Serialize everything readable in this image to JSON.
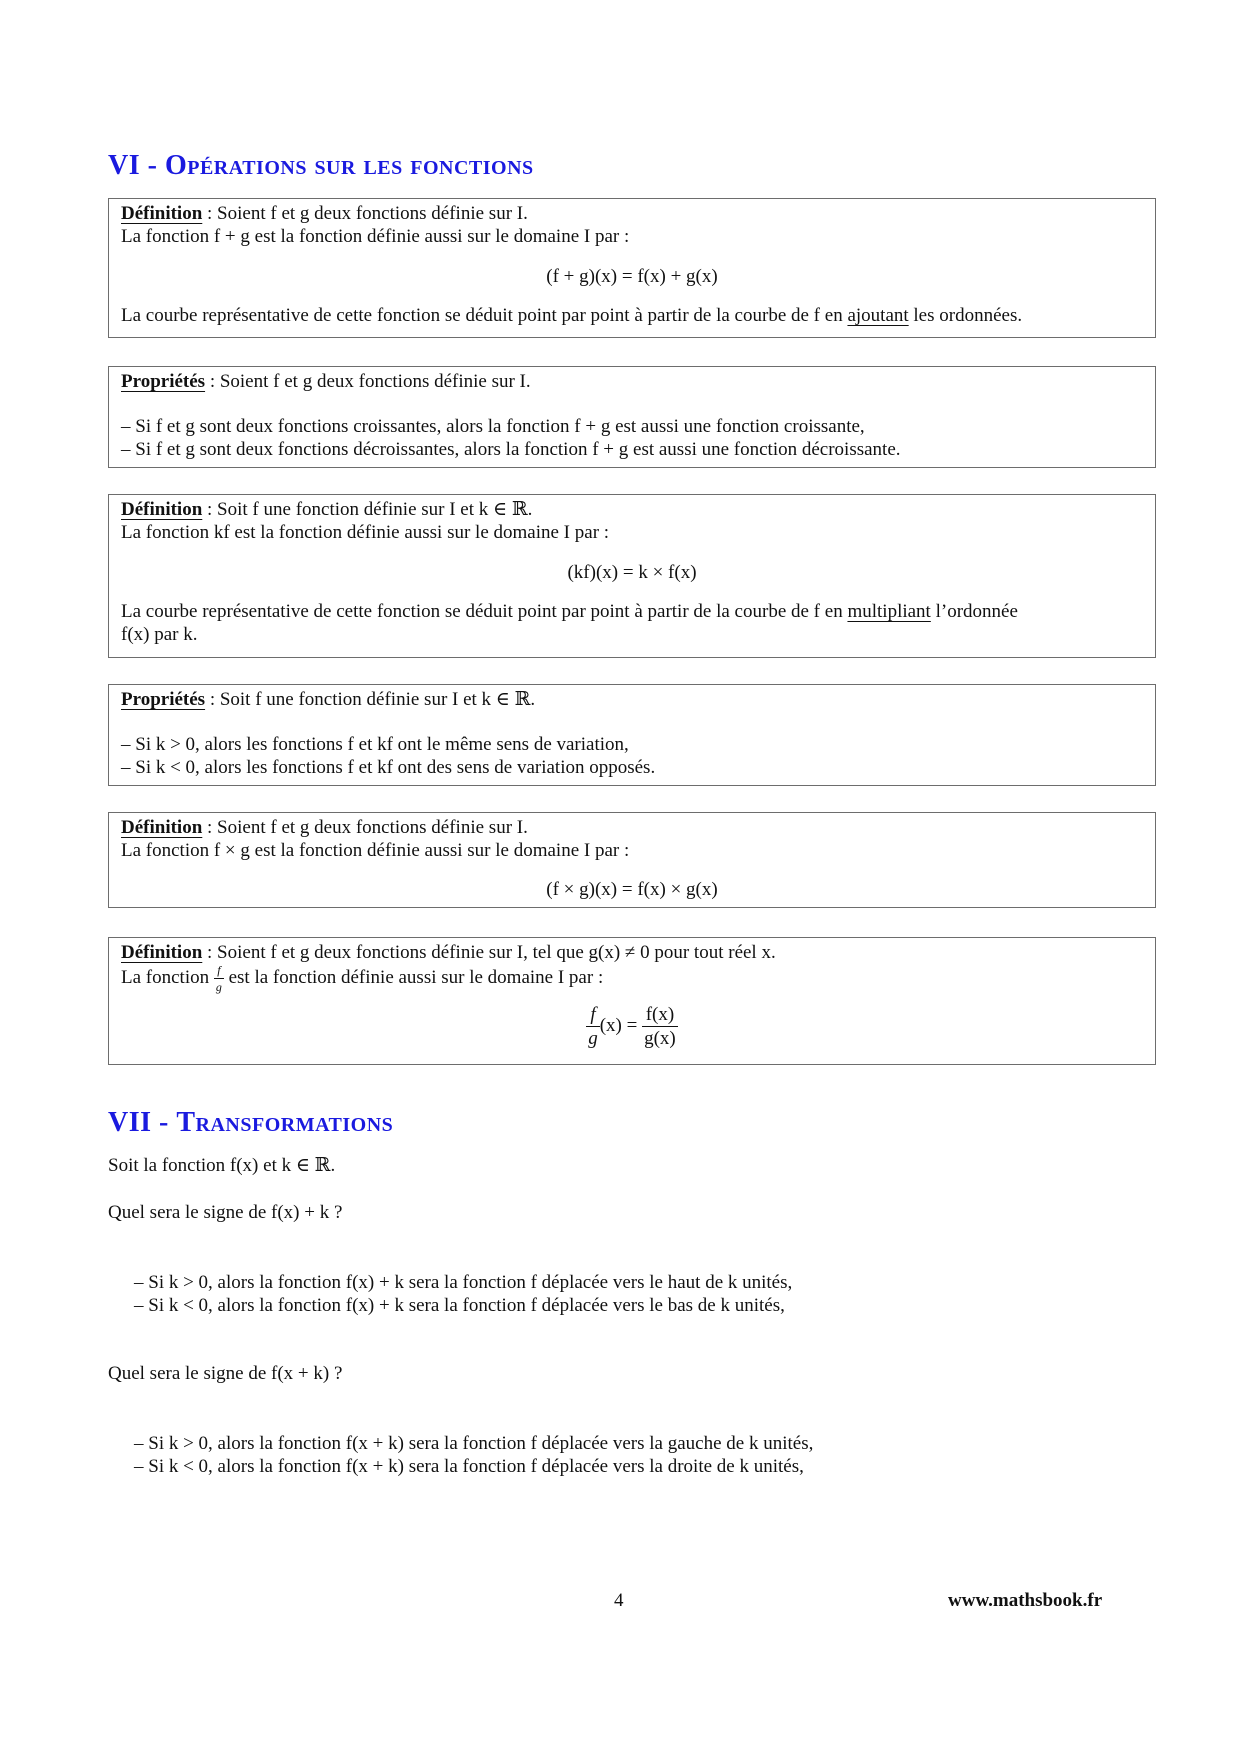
{
  "section6": {
    "number": "VI - ",
    "title": "Opérations sur les fonctions"
  },
  "box1": {
    "keyword": "Définition",
    "line1_rest": " : Soient f et g deux fonctions définie sur I.",
    "line2": "La fonction f + g est la fonction définie aussi sur le domaine I par :",
    "equation": "(f + g)(x) = f(x) + g(x)",
    "line3_before": "La courbe représentative de cette fonction se déduit point par point à partir de la courbe de f en ",
    "line3_underlined": "ajoutant",
    "line3_after": " les ordonnées."
  },
  "box2": {
    "keyword": "Propriétés",
    "line1_rest": " : Soient f et g deux fonctions définie sur I.",
    "items": [
      "– Si f et g sont deux fonctions croissantes, alors la fonction f + g est aussi une fonction croissante,",
      "– Si f et g sont deux fonctions décroissantes, alors la fonction f + g est aussi une fonction décroissante."
    ]
  },
  "box3": {
    "keyword": "Définition",
    "line1_rest": " : Soit f une fonction définie sur I et k ∈ ℝ.",
    "line2": "La fonction kf est la fonction définie aussi sur le domaine I par :",
    "equation": "(kf)(x) = k × f(x)",
    "line3_before": "La courbe représentative de cette fonction se déduit point par point à partir de la courbe de f en ",
    "line3_underlined": "multipliant",
    "line3_after": " l’ordonnée",
    "line4": "f(x) par k."
  },
  "box4": {
    "keyword": "Propriétés",
    "line1_rest": " : Soit f une fonction définie sur I et k ∈ ℝ.",
    "items": [
      "– Si k > 0, alors les fonctions f et kf ont le même sens de variation,",
      "– Si k < 0, alors les fonctions f et kf ont des sens de variation opposés."
    ]
  },
  "box5": {
    "keyword": "Définition",
    "line1_rest": " : Soient f et g deux fonctions définie sur I.",
    "line2": "La fonction f × g est la fonction définie aussi sur le domaine I par :",
    "equation": "(f × g)(x) = f(x) × g(x)"
  },
  "box6": {
    "keyword": "Définition",
    "line1_rest": " : Soient f et g deux fonctions définie sur I, tel que g(x) ≠ 0 pour tout réel x.",
    "line2_before": "La fonction ",
    "line2_frac_num": "f",
    "line2_frac_den": "g",
    "line2_after": " est la fonction définie aussi sur le domaine I par :",
    "eq_lhs_num": "f",
    "eq_lhs_den": "g",
    "eq_mid": "(x) = ",
    "eq_rhs_num": "f(x)",
    "eq_rhs_den": "g(x)"
  },
  "section7": {
    "number": "VII - ",
    "title": "Transformations",
    "intro": "Soit la fonction f(x) et k ∈ ℝ.",
    "question1": "Quel sera le signe de f(x) + k ?",
    "items1": [
      "– Si k > 0, alors la fonction f(x) + k sera la fonction f déplacée vers le haut de k unités,",
      "– Si k < 0, alors la fonction f(x) + k sera la fonction f déplacée vers le bas de k unités,"
    ],
    "question2": "Quel sera le signe de f(x + k) ?",
    "items2": [
      "– Si k > 0, alors la fonction f(x + k) sera la fonction f déplacée vers la gauche de k unités,",
      "– Si k < 0, alors la fonction f(x + k) sera la fonction f déplacée vers la droite de k unités,"
    ]
  },
  "footer": {
    "page_number": "4",
    "website": "www.mathsbook.fr"
  },
  "colors": {
    "heading": "#1a1adf",
    "box_border": "#6d6d6d",
    "text": "#111111"
  }
}
